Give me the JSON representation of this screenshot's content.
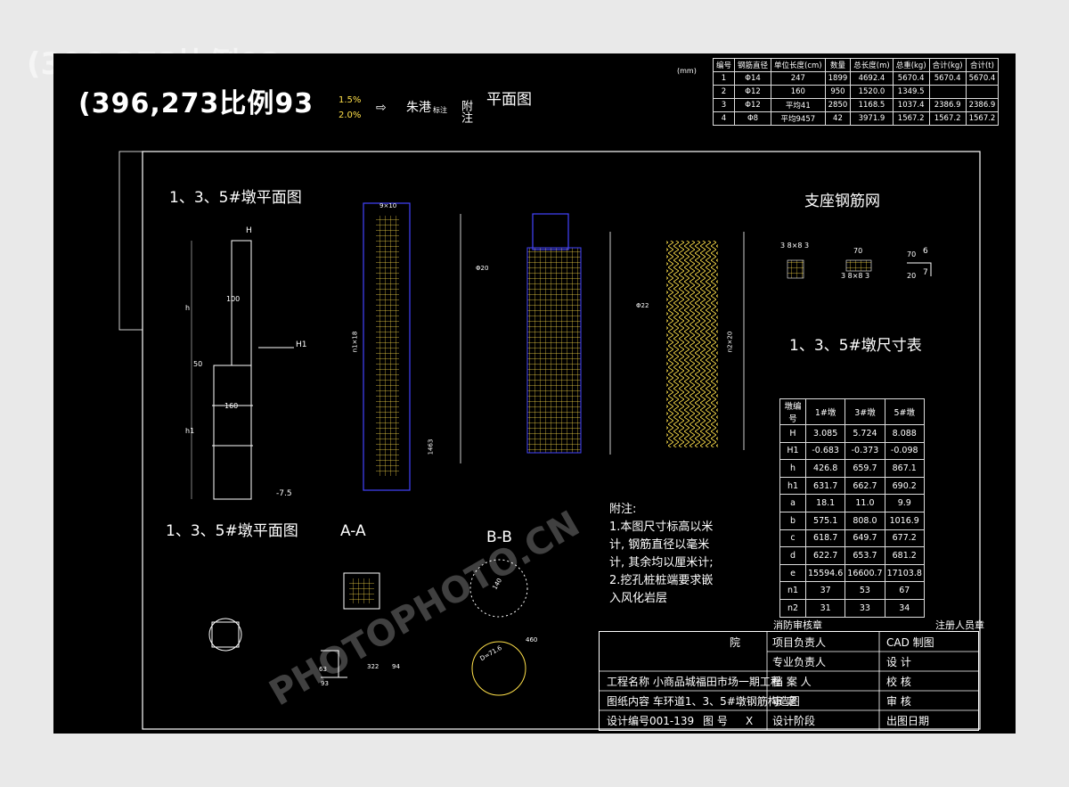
{
  "header": {
    "scale_label": "(396,273比例93",
    "slope_top": "1.5%",
    "slope_bottom": "2.0%",
    "legend_label": "朱港",
    "legend_sub": "标注",
    "note_heading": "附注",
    "plan_title": "平面图",
    "unit": "(mm)"
  },
  "quantity_table": {
    "headers": [
      "编号",
      "钢筋直径",
      "单位长度(cm)",
      "数量",
      "总长度(m)",
      "总重(kg)",
      "合计(kg)",
      "合计(t)"
    ],
    "rows": [
      [
        "1",
        "Φ14",
        "247",
        "1899",
        "4692.4",
        "5670.4",
        "5670.4",
        "5670.4"
      ],
      [
        "2",
        "Φ12",
        "160",
        "950",
        "1520.0",
        "1349.5",
        "",
        ""
      ],
      [
        "3",
        "Φ12",
        "平均41",
        "2850",
        "1168.5",
        "1037.4",
        "2386.9",
        "2386.9"
      ],
      [
        "4",
        "Φ8",
        "平均9457",
        "42",
        "3971.9",
        "1567.2",
        "1567.2",
        "1567.2"
      ]
    ]
  },
  "drawing": {
    "pier_plan_title": "1、3、5#墩平面图",
    "pier_plan_title_2": "1、3、5#墩平面图",
    "support_mesh_title": "支座钢筋网",
    "dim_table_title": "1、3、5#墩尺寸表",
    "section_aa": "A-A",
    "section_bb": "B-B",
    "labels": {
      "H": "H",
      "H1": "H1",
      "h": "h",
      "h1": "h1",
      "d100": "100",
      "d160": "160",
      "d50": "50",
      "elev": "-7.5",
      "grid": "9×10",
      "n1x18": "n1×18",
      "n2x20": "n2×20",
      "c1463": "1463",
      "b820": "Φ20",
      "b822": "Φ22",
      "mesh1": "3 8×8 3",
      "mesh2": "3 8×8 3",
      "mesh3": "70",
      "mesh_r6": "6",
      "mesh_r7": "7",
      "d70": "70",
      "d20": "20",
      "bb140": "140",
      "D716": "D=71.6",
      "d322": "322",
      "d94": "94",
      "d63": "63",
      "d93": "93",
      "d460": "460"
    }
  },
  "dim_table": {
    "headers": [
      "墩编号",
      "1#墩",
      "3#墩",
      "5#墩"
    ],
    "rows": [
      [
        "H",
        "3.085",
        "5.724",
        "8.088"
      ],
      [
        "H1",
        "-0.683",
        "-0.373",
        "-0.098"
      ],
      [
        "h",
        "426.8",
        "659.7",
        "867.1"
      ],
      [
        "h1",
        "631.7",
        "662.7",
        "690.2"
      ],
      [
        "a",
        "18.1",
        "11.0",
        "9.9"
      ],
      [
        "b",
        "575.1",
        "808.0",
        "1016.9"
      ],
      [
        "c",
        "618.7",
        "649.7",
        "677.2"
      ],
      [
        "d",
        "622.7",
        "653.7",
        "681.2"
      ],
      [
        "e",
        "15594.6",
        "16600.7",
        "17103.8"
      ],
      [
        "n1",
        "37",
        "53",
        "67"
      ],
      [
        "n2",
        "31",
        "33",
        "34"
      ]
    ]
  },
  "notes": {
    "title": "附注:",
    "items": [
      "1.本图尺寸标高以米计, 钢筋直径以毫米计, 其余均以厘米计;",
      "2.挖孔桩桩端要求嵌入风化岩层"
    ]
  },
  "title_block": {
    "stamp_fire": "消防审核章",
    "stamp_reg": "注册人员章",
    "institute": "院",
    "project_lead": "项目负责人",
    "discipline_lead": "专业负责人",
    "cad": "CAD 制图",
    "design": "设 计",
    "check": "校 核",
    "review": "审 核",
    "archive": "档 案 人",
    "approve": "审 定",
    "stage": "设计阶段",
    "date": "出图日期",
    "project_name": "工程名称 小商品城福田市场一期工程",
    "drawing_name": "图纸内容 车环道1、3、5#墩钢筋构造图",
    "design_no": "设计编号001-139",
    "drawing_no": "图 号",
    "drawing_no_val": "X"
  },
  "watermark": "PHOTOPHOTO.CN"
}
